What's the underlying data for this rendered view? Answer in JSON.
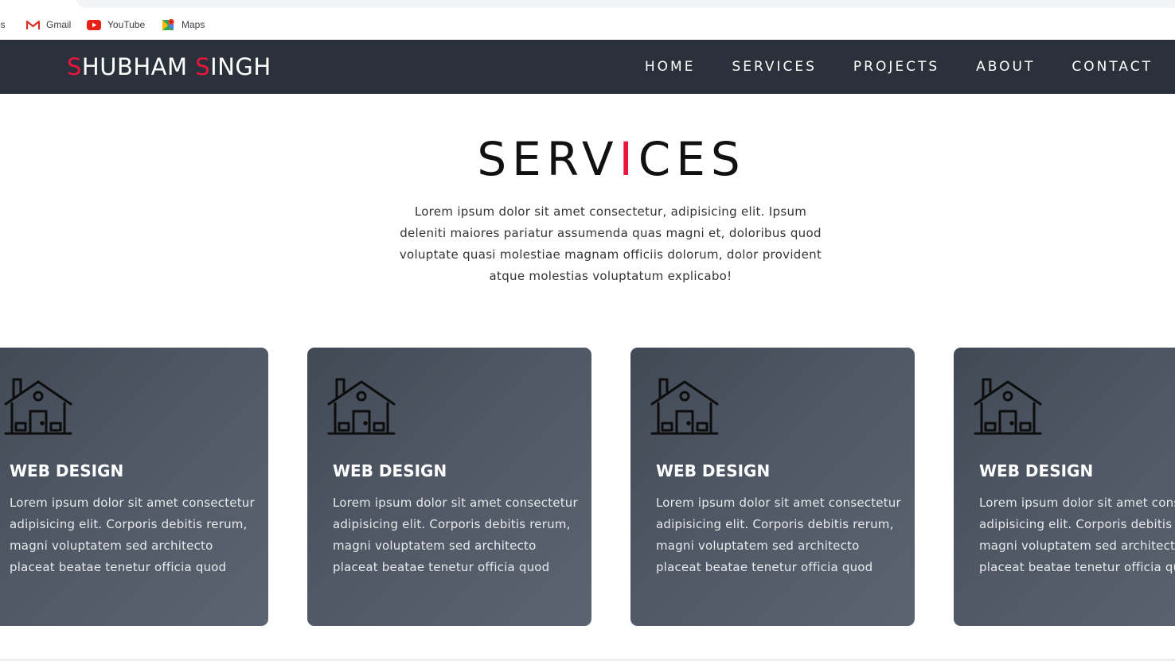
{
  "bookmarks": {
    "apps": "ps",
    "gmail": "Gmail",
    "youtube": "YouTube",
    "maps": "Maps"
  },
  "site": {
    "logo": {
      "first_initial": "S",
      "first_rest": "HUBHAM ",
      "last_initial": "S",
      "last_rest": "INGH"
    },
    "nav": [
      "HOME",
      "SERVICES",
      "PROJECTS",
      "ABOUT",
      "CONTACT"
    ]
  },
  "services": {
    "heading_before": "SERV",
    "heading_accent": "I",
    "heading_after": "CES",
    "intro": "Lorem ipsum dolor sit amet consectetur, adipisicing elit. Ipsum deleniti maiores pariatur assumenda quas magni et, doloribus quod voluptate quasi molestiae magnam officiis dolorum, dolor provident atque molestias voluptatum explicabo!",
    "cards": [
      {
        "icon": "house-icon",
        "title": "WEB DESIGN",
        "text": "Lorem ipsum dolor sit amet consectetur adipisicing elit. Corporis debitis rerum, magni voluptatem sed architecto placeat beatae tenetur officia quod"
      },
      {
        "icon": "house-icon",
        "title": "WEB DESIGN",
        "text": "Lorem ipsum dolor sit amet consectetur adipisicing elit. Corporis debitis rerum, magni voluptatem sed architecto placeat beatae tenetur officia quod"
      },
      {
        "icon": "house-icon",
        "title": "WEB DESIGN",
        "text": "Lorem ipsum dolor sit amet consectetur adipisicing elit. Corporis debitis rerum, magni voluptatem sed architecto placeat beatae tenetur officia quod"
      },
      {
        "icon": "house-icon",
        "title": "WEB DESIGN",
        "text": "Lorem ipsum dolor sit amet consectetur adipisicing elit. Corporis debitis rerum, magni voluptatem sed architecto placeat beatae tenetur officia quod"
      }
    ]
  },
  "colors": {
    "accent": "#e8163f",
    "nav_background": "#2b313a",
    "card_background": "#4f5864"
  }
}
